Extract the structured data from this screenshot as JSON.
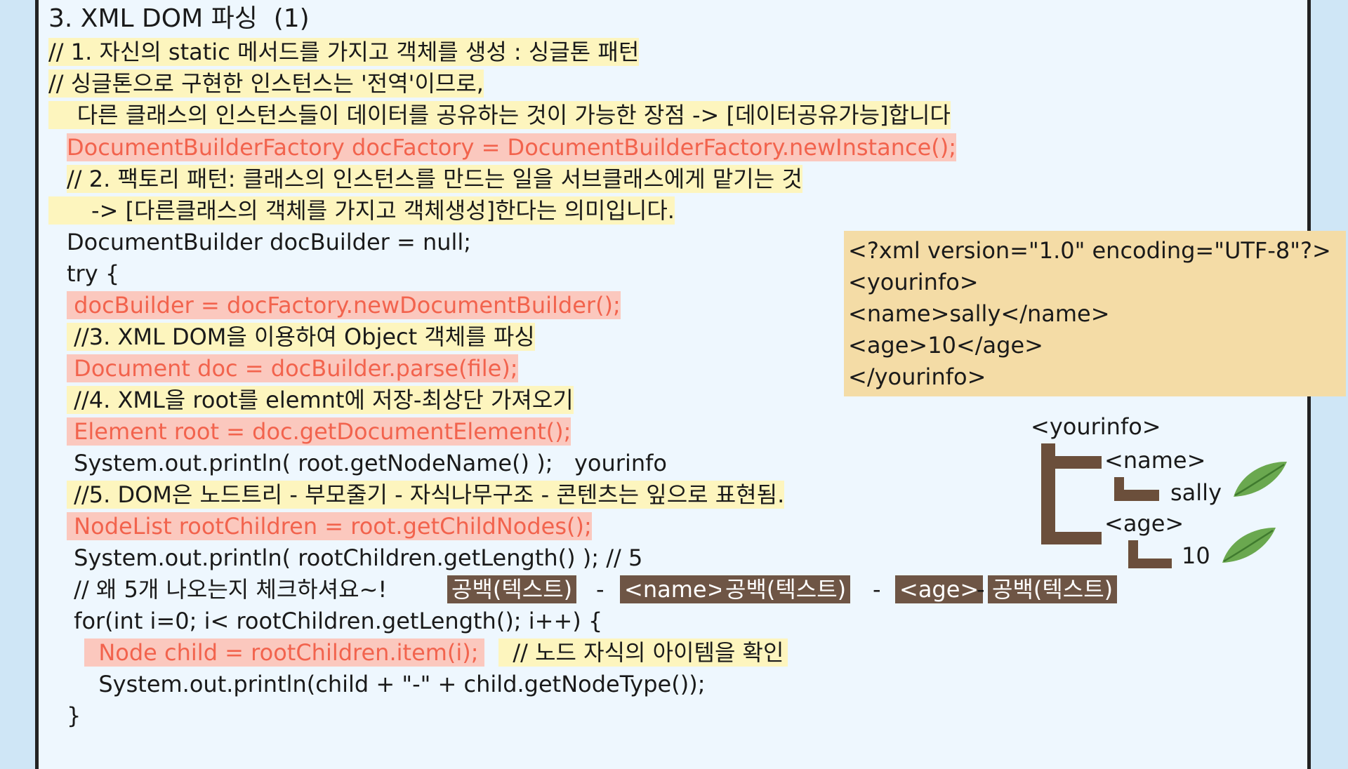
{
  "title": "3. XML DOM 파싱  (1)",
  "code_lines": [
    "// 1. 자신의 static 메서드를 가지고 객체를 생성 : 싱글톤 패턴",
    "// 싱글톤으로 구현한 인스턴스는 '전역'이므로,",
    "    다른 클래스의 인스턴스들이 데이터를 공유하는 것이 가능한 장점 -> [데이터공유가능]합니다",
    "DocumentBuilderFactory docFactory = DocumentBuilderFactory.newInstance();",
    "// 2. 팩토리 패턴: 클래스의 인스턴스를 만드는 일을 서브클래스에게 맡기는 것",
    "      -> [다른클래스의 객체를 가지고 객체생성]한다는 의미입니다.",
    "DocumentBuilder docBuilder = null;",
    "try {",
    " docBuilder = docFactory.newDocumentBuilder();",
    " //3. XML DOM을 이용하여 Object 객체를 파싱",
    " Document doc = docBuilder.parse(file);",
    " //4. XML을 root를 elemnt에 저장-최상단 가져오기",
    " Element root = doc.getDocumentElement();",
    " System.out.println( root.getNodeName() );   yourinfo",
    " //5. DOM은 노드트리 - 부모줄기 - 자식나무구조 - 콘텐츠는 잎으로 표현됨.",
    " NodeList rootChildren = root.getChildNodes();",
    " System.out.println( rootChildren.getLength() ); // 5",
    " // 왜 5개 나오는지 체크하셔요~!",
    " for(int i=0; i< rootChildren.getLength(); i++) {",
    "  Node child = rootChildren.item(i);",
    "  // 노드 자식의 아이템을 확인",
    "  System.out.println(child + \"-\" + child.getNodeType());",
    "}"
  ],
  "xml_lines": [
    "<?xml version=\"1.0\" encoding=\"UTF-8\"?>",
    "<yourinfo>",
    "<name>sally</name>",
    "<age>10</age>",
    "</yourinfo>"
  ],
  "children_row": {
    "tag1": "공백(텍스트)",
    "sep1": "-",
    "tag2": "<name>",
    "tag3": "공백(텍스트)",
    "sep2": "-",
    "tag4": "<age>",
    "sep3": "-",
    "tag5": "공백(텍스트)"
  },
  "tree": {
    "root": "<yourinfo>",
    "name_tag": "<name>",
    "name_value": "sally",
    "age_tag": "<age>",
    "age_value": "10"
  },
  "colors": {
    "highlight_yellow": "#fdf5be",
    "highlight_red": "#fbc8be",
    "code_red": "#f2634d",
    "xml_box": "#f4dca6",
    "tag_brown": "#6e5545",
    "tree_brown": "#6b4f3b",
    "leaf_green": "#6aa84f"
  },
  "icons": [
    "leaf-icon"
  ]
}
